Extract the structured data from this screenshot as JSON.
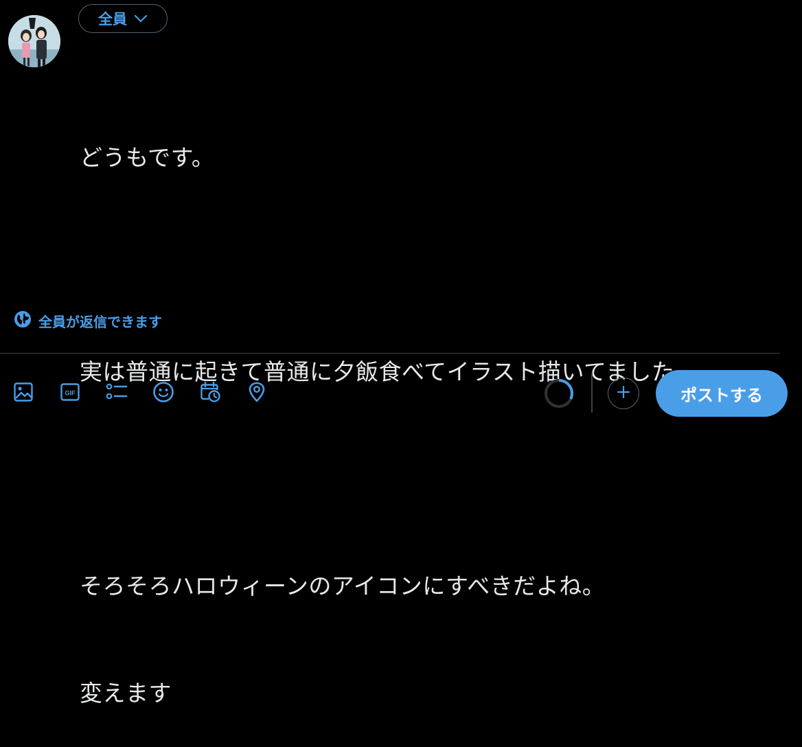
{
  "audience": {
    "label": "全員",
    "icon": "chevron-down-icon"
  },
  "compose": {
    "lines": [
      "どうもです。",
      "",
      "実は普通に起きて普通に夕飯食べてイラスト描いてました。",
      "",
      "そろそろハロウィーンのアイコンにすべきだよね。",
      "変えます"
    ]
  },
  "reply_setting": {
    "label": "全員が返信できます",
    "icon": "globe-icon"
  },
  "toolbar": {
    "items": [
      {
        "name": "image-icon",
        "label": ""
      },
      {
        "name": "gif-icon",
        "label": "GIF"
      },
      {
        "name": "poll-icon",
        "label": ""
      },
      {
        "name": "emoji-icon",
        "label": ""
      },
      {
        "name": "schedule-icon",
        "label": ""
      },
      {
        "name": "location-icon",
        "label": ""
      }
    ]
  },
  "character_progress": 0.32,
  "post_button": {
    "label": "ポストする"
  },
  "colors": {
    "accent": "#4a9ee8",
    "background": "#000000",
    "text": "#e7e9ea",
    "border": "#536471"
  }
}
